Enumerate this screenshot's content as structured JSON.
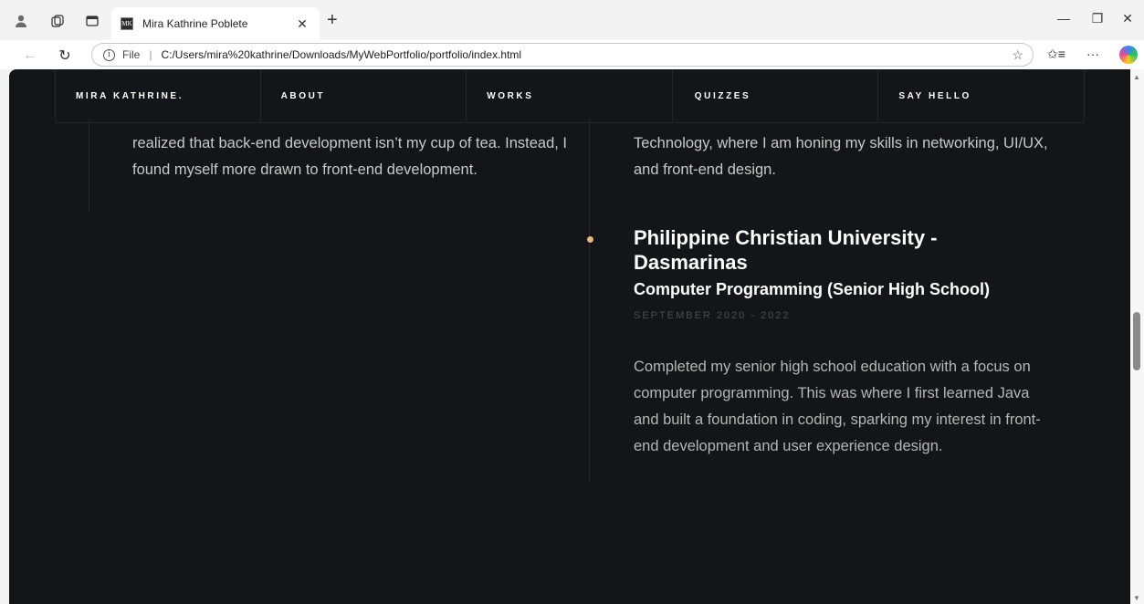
{
  "browser": {
    "tab_title": "Mira Kathrine Poblete",
    "tab_favicon_text": "MK",
    "address_file_label": "File",
    "address_url": "C:/Users/mira%20kathrine/Downloads/MyWebPortfolio/portfolio/index.html",
    "icons": [
      "profile-icon",
      "workspaces-icon",
      "tab-actions-icon",
      "close-icon",
      "plus-icon",
      "minimize-icon",
      "restore-icon",
      "window-close-icon",
      "back-icon",
      "refresh-icon",
      "info-icon",
      "favorite-star-icon",
      "favorites-list-icon",
      "more-icon",
      "copilot-icon"
    ]
  },
  "nav": {
    "brand": "MIRA KATHRINE.",
    "items": [
      "ABOUT",
      "WORKS",
      "QUIZZES",
      "SAY HELLO"
    ]
  },
  "timeline": {
    "left_paragraph": "realized that back-end development isn’t my cup of tea. Instead, I found myself more drawn to front-end development.",
    "right_top_paragraph": "Technology, where I am honing my skills in networking, UI/UX, and front-end design.",
    "entry": {
      "school": "Philippine Christian University - Dasmarinas",
      "program": "Computer Programming (Senior High School)",
      "dates": "SEPTEMBER 2020 - 2022",
      "description": "Completed my senior high school education with a focus on computer programming. This was where I first learned Java and built a foundation in coding, sparking my interest in front-end development and user experience design."
    }
  },
  "colors": {
    "page_bg": "#141518",
    "accent_dot": "#e7b77b",
    "text": "#c9c9c9"
  }
}
